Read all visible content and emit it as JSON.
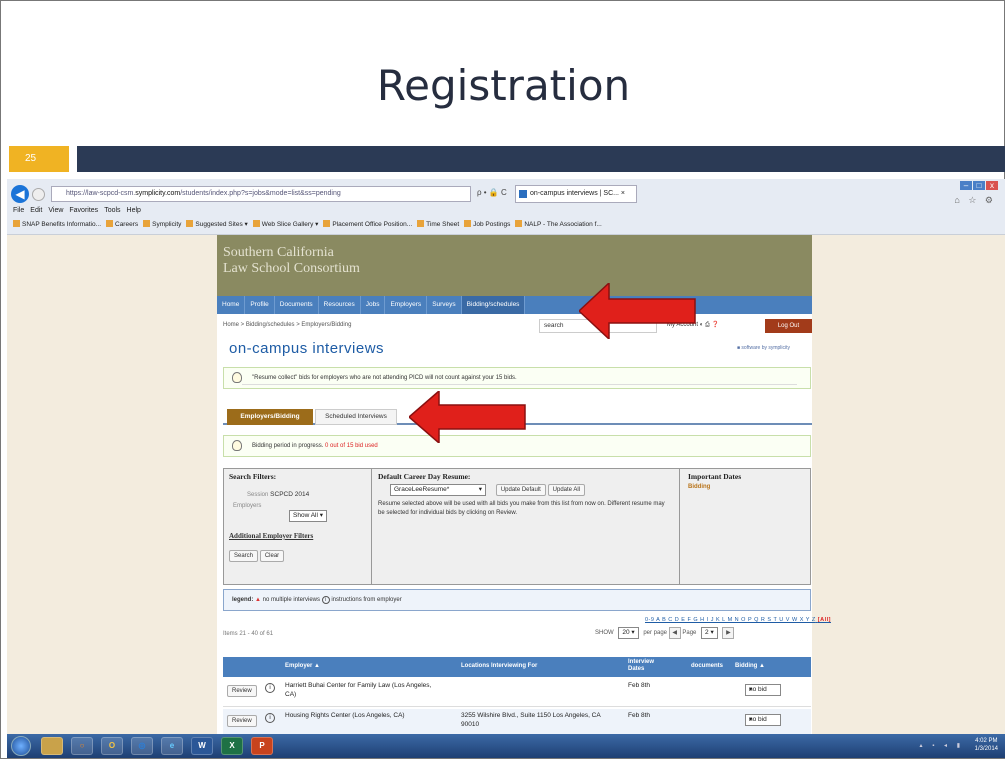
{
  "slide": {
    "title": "Registration",
    "number": "25"
  },
  "browser": {
    "address_prefix": "https://law-scpcd-csm.",
    "address_domain": "symplicity.com",
    "address_suffix": "/students/index.php?s=jobs&mode=list&ss=pending",
    "address_icons": "ρ • 🔒 C",
    "tab_title": "on-campus interviews | SC...",
    "tab_close": "×",
    "menu": [
      "File",
      "Edit",
      "View",
      "Favorites",
      "Tools",
      "Help"
    ],
    "favorites": [
      "SNAP Benefits Informatio...",
      "Careers",
      "Symplicity",
      "Suggested Sites ▾",
      "Web Slice Gallery ▾",
      "Placement Office Position...",
      "Time Sheet",
      "Job Postings",
      "NALP - The Association f..."
    ],
    "win_buttons": [
      "–",
      "□",
      "x"
    ],
    "corner_icons": "⌂ ☆ ⚙",
    "back_glyph": "◀"
  },
  "site": {
    "banner_line1": "Southern California",
    "banner_line2": "Law School Consortium",
    "nav": [
      "Home",
      "Profile",
      "Documents",
      "Resources",
      "Jobs",
      "Employers",
      "Surveys",
      "Bidding/schedules"
    ],
    "breadcrumb": "Home > Bidding/schedules > Employers/Bidding",
    "search_value": "search",
    "account": "My Account",
    "account_icons": "◐ ⎙ ❓",
    "logout": "Log Out",
    "page_title": "on-campus interviews",
    "software_by": "■ software by symplicity",
    "notice1": "\"Resume collect\" bids for employers who are not attending PICD will not count against your 15 bids.",
    "tab_active": "Employers/Bidding",
    "tab_other": "Scheduled Interviews",
    "notice2_prefix": "Bidding period in progress. ",
    "notice2_count": "0 out of 15 bid used"
  },
  "filters": {
    "heading": "Search Filters:",
    "session_label": "Session",
    "session_value": "SCPCD 2014",
    "employers_label": "Employers",
    "employers_value": "Show All",
    "additional_link": "Additional Employer Filters",
    "search_btn": "Search",
    "clear_btn": "Clear",
    "resume_heading": "Default Career Day Resume:",
    "resume_value": "GraceLeeResume*",
    "update_default": "Update Default",
    "update_all": "Update All",
    "resume_note": "Resume selected above will be used with all bids you make from this list from now on. Different resume may be selected for individual bids by clicking on Review.",
    "dates_heading": "Important Dates",
    "dates_item": "Bidding"
  },
  "legend": {
    "label": "legend:",
    "item1": "no multiple interviews",
    "item2": "instructions from employer"
  },
  "listing": {
    "letters": "0-9 A B C D E F G H I J K L M N O P Q R S T U V W X Y Z",
    "letters_all": "[All]",
    "items": "Items 21 - 40 of 61",
    "show_label": "SHOW",
    "show_value": "20",
    "per_page": "per page",
    "page_label": "Page",
    "page_value": "2",
    "headers": {
      "employer": "Employer ▲",
      "locations": "Locations Interviewing For",
      "dates": "Interview Dates",
      "documents": "documents",
      "bidding": "Bidding ▲"
    },
    "rows": [
      {
        "review": "Review",
        "employer": "Harriett Buhai Center for Family Law (Los Angeles,",
        "employer2": "CA)",
        "location": "",
        "location2": "",
        "date": "Feb 8th",
        "bid": "no bid"
      },
      {
        "review": "Review",
        "employer": "Housing Rights Center (Los Angeles, CA)",
        "employer2": "",
        "location": "3255 Wilshire Blvd., Suite 1150 Los Angeles, CA",
        "location2": "90010",
        "date": "Feb 8th",
        "bid": "no bid"
      }
    ]
  },
  "taskbar": {
    "apps": [
      "e",
      "○",
      "O",
      "◎",
      "W",
      "X",
      "P"
    ],
    "time": "4:02 PM",
    "date": "1/3/2014"
  }
}
